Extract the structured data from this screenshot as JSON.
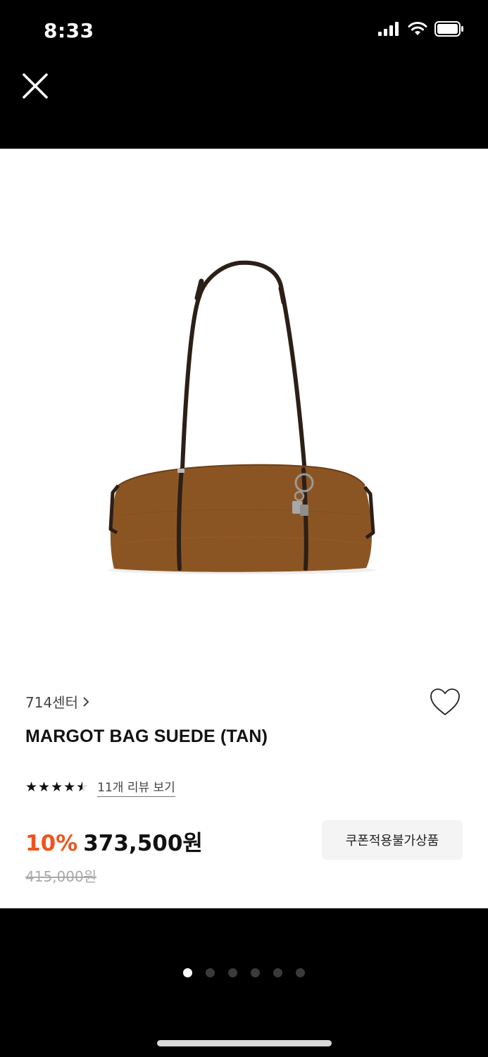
{
  "status_bar": {
    "time": "8:33"
  },
  "product": {
    "store_link": "714센터",
    "title": "MARGOT BAG SUEDE (TAN)",
    "rating": 4.5,
    "review_link": "11개 리뷰 보기",
    "discount": "10%",
    "sale_price": "373,500원",
    "original_price": "415,000원",
    "coupon_badge": "쿠폰적용불가상품"
  },
  "gallery": {
    "total": 6,
    "active_index": 0
  },
  "icons": {
    "close": "close-icon",
    "wishlist": "heart-outline-icon",
    "store_chevron": "chevron-right-icon"
  },
  "colors": {
    "discount": "#f0541e",
    "bag": "#8b5523",
    "strap": "#2c1f18"
  }
}
